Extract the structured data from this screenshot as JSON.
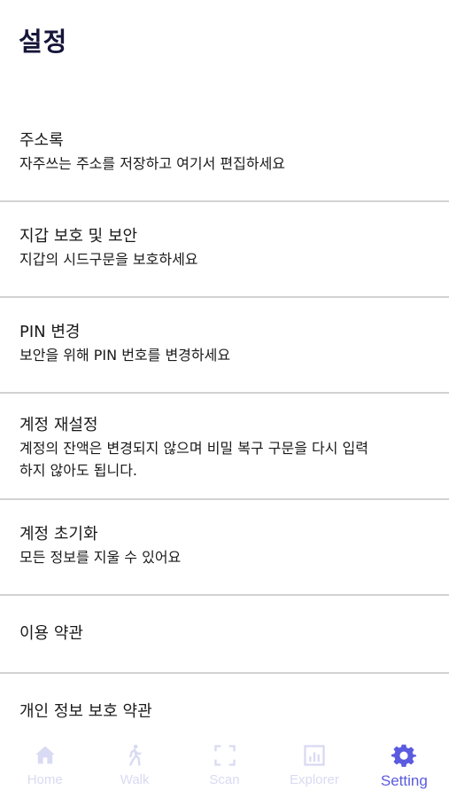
{
  "header": {
    "title": "설정"
  },
  "settings": [
    {
      "title": "주소록",
      "desc": "자주쓰는 주소를 저장하고 여기서 편집하세요"
    },
    {
      "title": "지갑 보호 및 보안",
      "desc": "지갑의 시드구문을 보호하세요"
    },
    {
      "title": "PIN 변경",
      "desc": "보안을 위해 PIN 번호를 변경하세요"
    },
    {
      "title": "계정 재설정",
      "desc_line1": "계정의 잔액은 변경되지 않으며 비밀 복구 구문을 다시 입력",
      "desc_line2": "하지 않아도 됩니다."
    },
    {
      "title": "계정 초기화",
      "desc": "모든 정보를 지울 수 있어요"
    },
    {
      "title": "이용 약관"
    },
    {
      "title": "개인 정보 보호 약관"
    }
  ],
  "nav": {
    "tabs": [
      {
        "label": "Home",
        "icon": "home-icon",
        "active": false
      },
      {
        "label": "Walk",
        "icon": "walk-icon",
        "active": false
      },
      {
        "label": "Scan",
        "icon": "scan-icon",
        "active": false
      },
      {
        "label": "Explorer",
        "icon": "explorer-icon",
        "active": false
      },
      {
        "label": "Setting",
        "icon": "gear-icon",
        "active": true
      }
    ],
    "active_color": "#5a5be0",
    "inactive_color": "#d9daf3"
  }
}
